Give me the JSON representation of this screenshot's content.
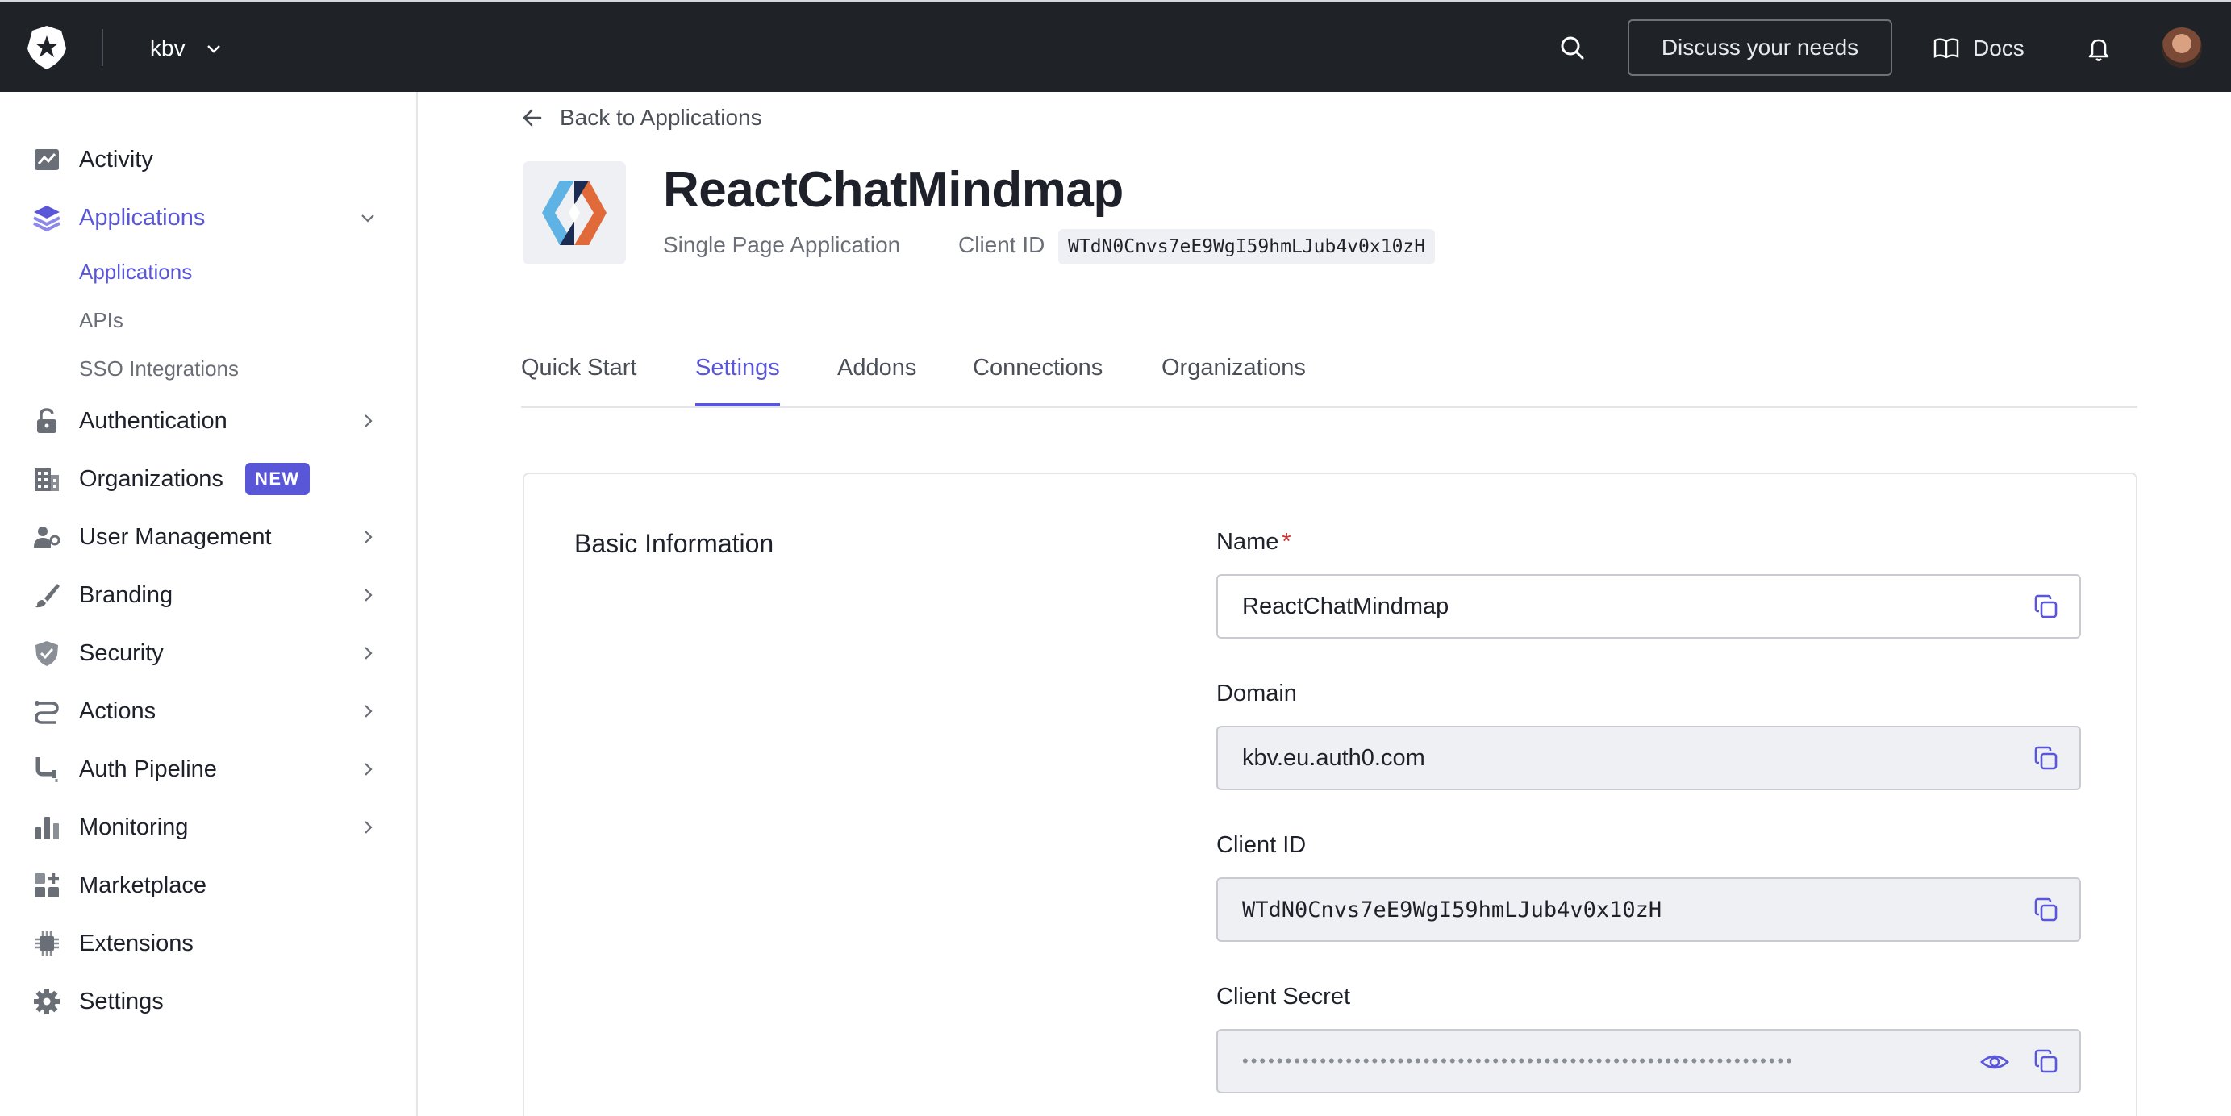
{
  "topbar": {
    "tenant": "kbv",
    "discuss_label": "Discuss your needs",
    "docs_label": "Docs"
  },
  "sidebar": {
    "items": [
      {
        "label": "Activity",
        "icon": "activity-icon"
      },
      {
        "label": "Applications",
        "icon": "layers-icon",
        "active": true,
        "expanded": true,
        "children": [
          "Applications",
          "APIs",
          "SSO Integrations"
        ]
      },
      {
        "label": "Authentication",
        "icon": "lock-icon"
      },
      {
        "label": "Organizations",
        "icon": "building-icon",
        "badge": "NEW"
      },
      {
        "label": "User Management",
        "icon": "user-gear-icon"
      },
      {
        "label": "Branding",
        "icon": "brush-icon"
      },
      {
        "label": "Security",
        "icon": "shield-check-icon"
      },
      {
        "label": "Actions",
        "icon": "flow-icon"
      },
      {
        "label": "Auth Pipeline",
        "icon": "pipe-icon"
      },
      {
        "label": "Monitoring",
        "icon": "bar-chart-icon"
      },
      {
        "label": "Marketplace",
        "icon": "grid-plus-icon"
      },
      {
        "label": "Extensions",
        "icon": "chip-icon"
      },
      {
        "label": "Settings",
        "icon": "gear-icon"
      }
    ]
  },
  "header": {
    "back_label": "Back to Applications",
    "app_name": "ReactChatMindmap",
    "app_type": "Single Page Application",
    "client_id_label": "Client ID",
    "client_id": "WTdN0Cnvs7eE9WgI59hmLJub4v0x10zH"
  },
  "tabs": [
    "Quick Start",
    "Settings",
    "Addons",
    "Connections",
    "Organizations"
  ],
  "active_tab": "Settings",
  "basic_info": {
    "title": "Basic Information",
    "name_label": "Name",
    "name_required_mark": "*",
    "name_value": "ReactChatMindmap",
    "domain_label": "Domain",
    "domain_value": "kbv.eu.auth0.com",
    "client_id_label": "Client ID",
    "client_id_value": "WTdN0Cnvs7eE9WgI59hmLJub4v0x10zH",
    "client_secret_label": "Client Secret",
    "client_secret_masked": "••••••••••••••••••••••••••••••••••••••••••••••••••••••••••••••••"
  },
  "colors": {
    "topbar_bg": "#1f2328",
    "accent": "#5a56d8",
    "required": "#d0302f"
  }
}
